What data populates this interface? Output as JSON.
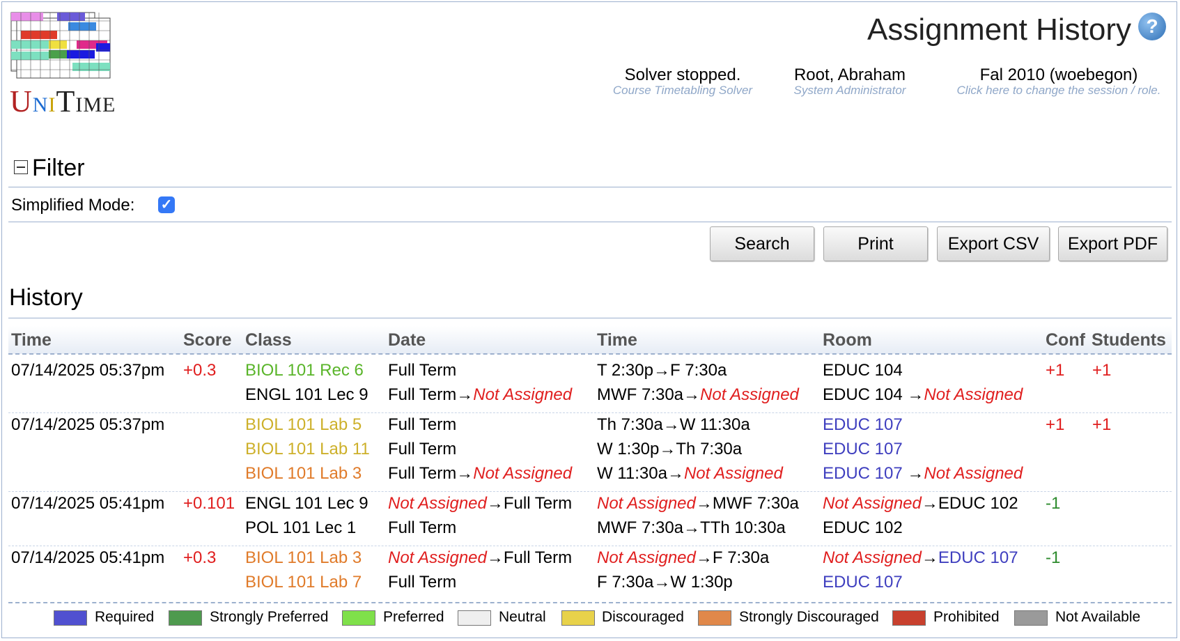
{
  "app": {
    "name_part1": "Uni",
    "name_part2": "Time",
    "logo_alt": "UniTime"
  },
  "header": {
    "title": "Assignment History",
    "help_icon": "help-icon",
    "status": [
      {
        "main": "Solver stopped.",
        "sub": "Course Timetabling Solver"
      },
      {
        "main": "Root, Abraham",
        "sub": "System Administrator"
      },
      {
        "main": "Fal 2010 (woebegon)",
        "sub": "Click here to change the session / role."
      }
    ]
  },
  "filter": {
    "title": "Filter",
    "simplified_label": "Simplified Mode:",
    "simplified_checked": true
  },
  "buttons": {
    "search": "Search",
    "print": "Print",
    "export_csv": "Export CSV",
    "export_pdf": "Export PDF"
  },
  "history": {
    "title": "History",
    "columns": [
      "Time",
      "Score",
      "Class",
      "Date",
      "Time",
      "Room",
      "Conf",
      "Students"
    ],
    "rows": [
      {
        "time": "07/14/2025 05:37pm",
        "score": "+0.3",
        "class": "BIOL 101 Rec 6",
        "date": "Full Term",
        "date_to": "",
        "class_time": "T 2:30p",
        "class_time_to": "F 7:30a",
        "room": "EDUC 104",
        "room_to": "",
        "conf": "+1",
        "students": "+1"
      },
      {
        "time": "",
        "score": "",
        "class": "ENGL 101 Lec 9",
        "date": "Full Term",
        "date_to": "Not Assigned",
        "class_time": "MWF 7:30a",
        "class_time_to": "Not Assigned",
        "room": "EDUC 104",
        "room_to": "Not Assigned",
        "conf": "",
        "students": ""
      },
      {
        "time": "07/14/2025 05:37pm",
        "score": "",
        "class": "BIOL 101 Lab 5",
        "date": "Full Term",
        "date_to": "",
        "class_time": "Th 7:30a",
        "class_time_to": "W 11:30a",
        "room": "EDUC 107",
        "room_to": "",
        "conf": "+1",
        "students": "+1"
      },
      {
        "time": "",
        "score": "",
        "class": "BIOL 101 Lab 11",
        "date": "Full Term",
        "date_to": "",
        "class_time": "W 1:30p",
        "class_time_to": "Th 7:30a",
        "room": "EDUC 107",
        "room_to": "",
        "conf": "",
        "students": ""
      },
      {
        "time": "",
        "score": "",
        "class": "BIOL 101 Lab 3",
        "date": "Full Term",
        "date_to": "Not Assigned",
        "class_time": "W 11:30a",
        "class_time_to": "Not Assigned",
        "room": "EDUC 107",
        "room_to": "Not Assigned",
        "conf": "",
        "students": ""
      },
      {
        "time": "07/14/2025 05:41pm",
        "score": "+0.101",
        "class": "ENGL 101 Lec 9",
        "date": "Not Assigned",
        "date_to": "Full Term",
        "class_time": "Not Assigned",
        "class_time_to": "MWF 7:30a",
        "room": "Not Assigned",
        "room_to": "EDUC 102",
        "conf": "-1",
        "students": ""
      },
      {
        "time": "",
        "score": "",
        "class": "POL 101 Lec 1",
        "date": "Full Term",
        "date_to": "",
        "class_time": "MWF 7:30a",
        "class_time_to": "TTh 10:30a",
        "room": "EDUC 102",
        "room_to": "",
        "conf": "",
        "students": ""
      },
      {
        "time": "07/14/2025 05:41pm",
        "score": "+0.3",
        "class": "BIOL 101 Lab 3",
        "date": "Not Assigned",
        "date_to": "Full Term",
        "class_time": "Not Assigned",
        "class_time_to": "F 7:30a",
        "room": "Not Assigned",
        "room_to": "EDUC 107",
        "conf": "-1",
        "students": ""
      },
      {
        "time": "",
        "score": "",
        "class": "BIOL 101 Lab 7",
        "date": "Full Term",
        "date_to": "",
        "class_time": "F 7:30a",
        "class_time_to": "W 1:30p",
        "room": "EDUC 107",
        "room_to": "",
        "conf": "",
        "students": ""
      }
    ]
  },
  "legend": [
    {
      "label": "Required",
      "color": "#5050d0"
    },
    {
      "label": "Strongly Preferred",
      "color": "#4e9a4e"
    },
    {
      "label": "Preferred",
      "color": "#7fe04a"
    },
    {
      "label": "Neutral",
      "color": "#efefef"
    },
    {
      "label": "Discouraged",
      "color": "#e8d24a"
    },
    {
      "label": "Strongly Discouraged",
      "color": "#e0884a"
    },
    {
      "label": "Prohibited",
      "color": "#c8402e"
    },
    {
      "label": "Not Available",
      "color": "#9a9a9a"
    }
  ]
}
